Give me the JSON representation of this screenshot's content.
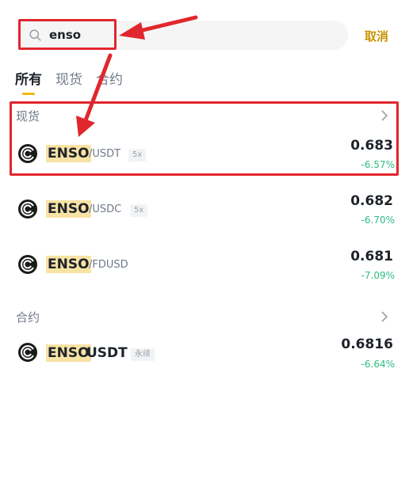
{
  "search": {
    "value": "enso"
  },
  "cancel_label": "取消",
  "tabs": [
    "所有",
    "现货",
    "合约"
  ],
  "spot_section": {
    "title": "现货"
  },
  "futures_section": {
    "title": "合约"
  },
  "spot_rows": [
    {
      "base": "ENSO",
      "quote": "/USDT",
      "badge": "5x",
      "price": "0.683",
      "change": "-6.57%"
    },
    {
      "base": "ENSO",
      "quote": "/USDC",
      "badge": "5x",
      "price": "0.682",
      "change": "-6.70%"
    },
    {
      "base": "ENSO",
      "quote": "/FDUSD",
      "badge": "",
      "price": "0.681",
      "change": "-7.09%"
    }
  ],
  "futures_rows": [
    {
      "base": "ENSO",
      "quote": "USDT",
      "badge": "永续",
      "price": "0.6816",
      "change": "-6.64%"
    }
  ],
  "colors": {
    "accent": "#f0b90b",
    "cancel": "#c99400",
    "down": "#2ebd85",
    "annotation": "#e0272d",
    "highlight": "#f8e3a5"
  },
  "icons": {
    "search": "search-icon",
    "chevron": "chevron-right-icon",
    "coin": "enso-coin-icon"
  }
}
